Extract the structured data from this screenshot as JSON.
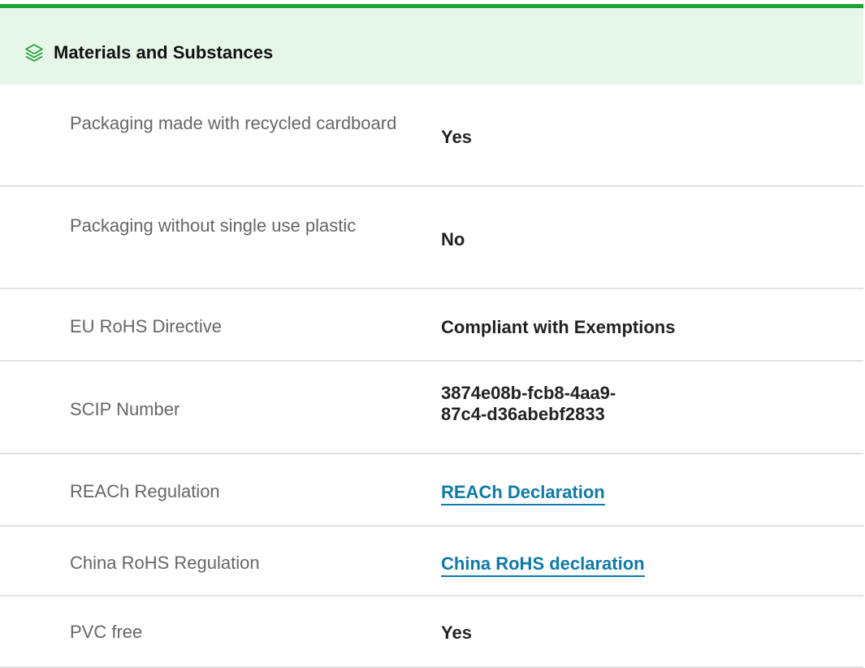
{
  "section": {
    "title": "Materials and Substances",
    "icon": "layers-icon",
    "accent_color": "#1ea135",
    "header_background": "#e6f7e9",
    "link_color": "#0d7aa8"
  },
  "rows": [
    {
      "label": "Packaging made with recycled cardboard",
      "value": "Yes"
    },
    {
      "label": "Packaging without single use plastic",
      "value": "No"
    },
    {
      "label": "EU RoHS Directive",
      "value": "Compliant with Exemptions"
    },
    {
      "label": "SCIP Number",
      "value": "3874e08b-fcb8-4aa9-87c4-d36abebf2833"
    },
    {
      "label": "REACh Regulation",
      "link": "REACh Declaration"
    },
    {
      "label": "China RoHS Regulation",
      "link": "China RoHS declaration"
    },
    {
      "label": "PVC free",
      "value": "Yes"
    }
  ]
}
